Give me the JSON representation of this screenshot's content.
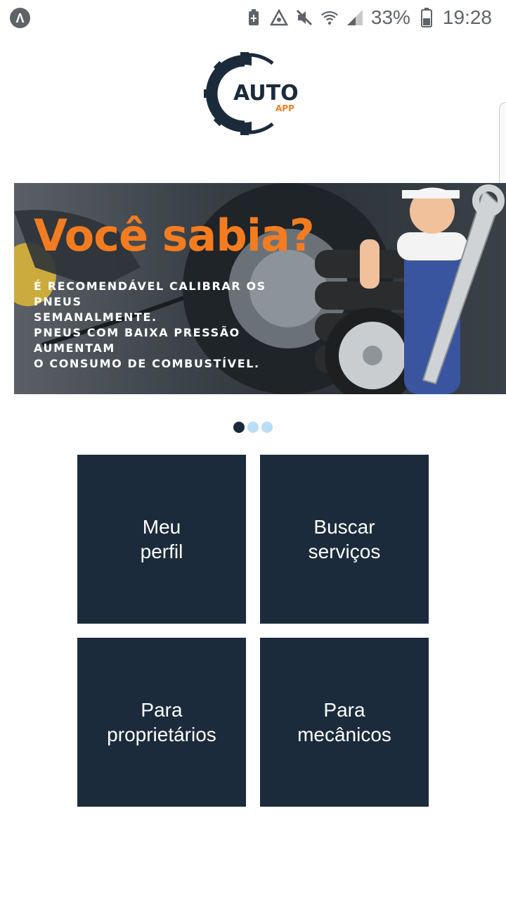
{
  "status_bar": {
    "app_icon": "Λ",
    "icons": [
      "battery-saver-icon",
      "data-saver-icon",
      "mute-icon",
      "wifi-icon",
      "signal-icon"
    ],
    "battery": "33%",
    "time": "19:28"
  },
  "logo": {
    "main": "AUTO",
    "sub": "APP"
  },
  "banner": {
    "title": "Você sabia?",
    "lines": [
      "É RECOMENDÁVEL CALIBRAR OS PNEUS",
      "SEMANALMENTE.",
      "PNEUS COM BAIXA PRESSÃO AUMENTAM",
      "O CONSUMO DE COMBUSTÍVEL."
    ]
  },
  "carousel": {
    "total": 3,
    "active_index": 0
  },
  "menu": [
    {
      "line1": "Meu",
      "line2": "perfil"
    },
    {
      "line1": "Buscar",
      "line2": "serviços"
    },
    {
      "line1": "Para",
      "line2": "proprietários"
    },
    {
      "line1": "Para",
      "line2": "mecânicos"
    }
  ],
  "colors": {
    "primary": "#1b2b3b",
    "accent": "#f47c20",
    "dot_inactive": "#b9def5"
  }
}
